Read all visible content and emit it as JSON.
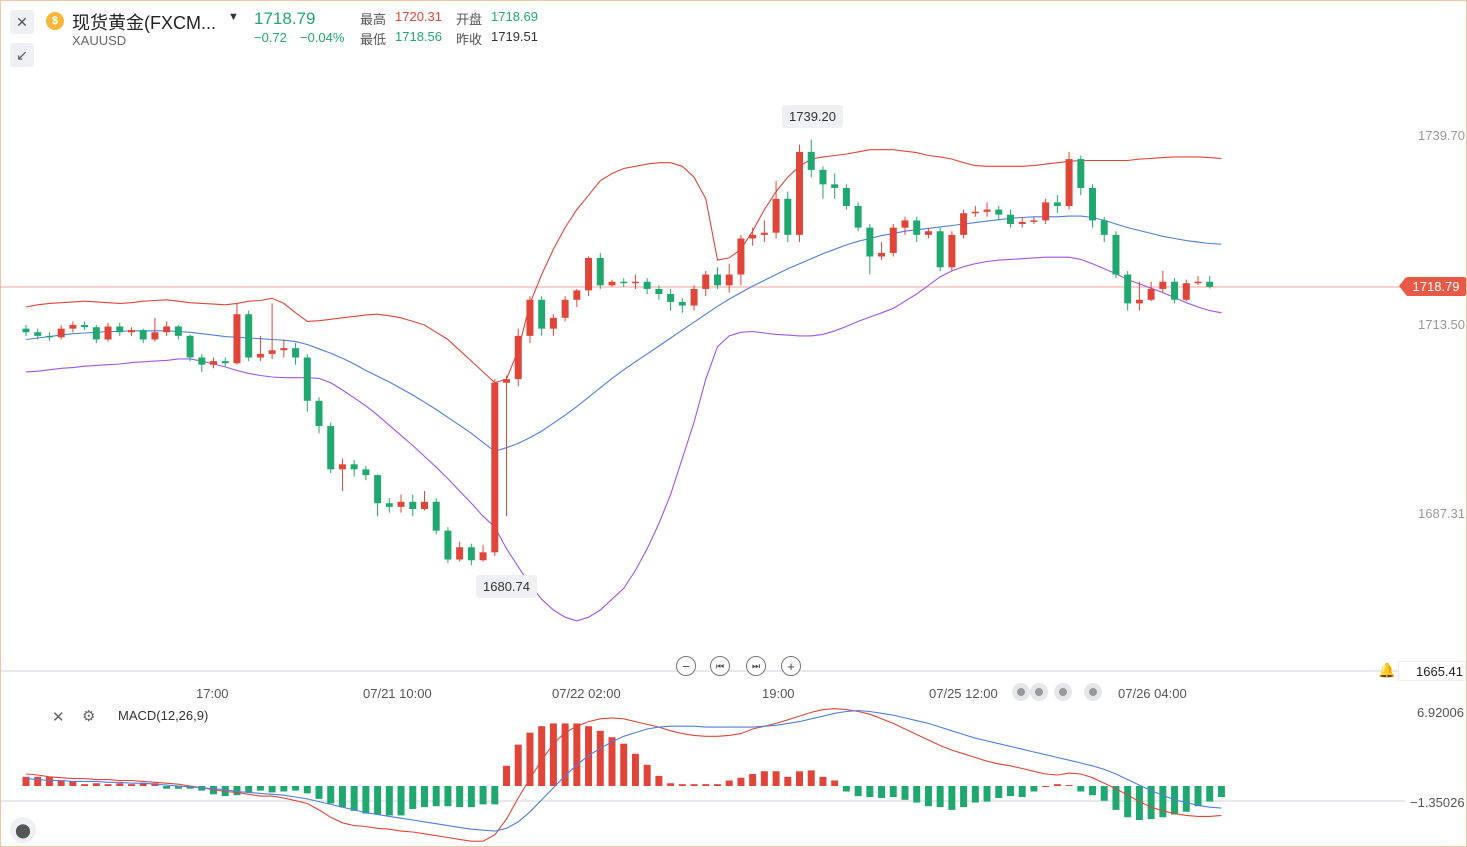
{
  "header": {
    "title": "现货黄金(FXCM...",
    "symbol": "XAUUSD",
    "price": "1718.79",
    "change": "−0.72",
    "change_pct": "−0.04%",
    "high_label": "最高",
    "high_value": "1720.31",
    "open_label": "开盘",
    "open_value": "1718.69",
    "low_label": "最低",
    "low_value": "1718.56",
    "prev_label": "昨收",
    "prev_value": "1719.51",
    "coin_glyph": "$"
  },
  "colors": {
    "up": "#e0453a",
    "down": "#21a870",
    "mid_band": "#4f7fe0",
    "lower_band": "#a055e6",
    "upper_band": "#e0453a"
  },
  "icons": {
    "close": "close-icon",
    "collapse": "collapse-icon",
    "dropdown": "caret-down-icon",
    "alarm": "bell-icon",
    "settings": "gear-icon",
    "indicator": "candles-icon"
  },
  "controls": {
    "zoom_out": "−",
    "prev": "⏮",
    "next": "⏭",
    "zoom_in": "+"
  },
  "chart_data": {
    "type": "candlestick",
    "price_axis": {
      "ticks": [
        "1739.70",
        "1713.50",
        "1687.31",
        "1665.41"
      ],
      "ylim": [
        1660,
        1745
      ]
    },
    "current_price": "1718.79",
    "annotations": {
      "high_marker": "1739.20",
      "low_marker": "1680.74"
    },
    "time_labels": [
      "17:00",
      "07/21 10:00",
      "07/22 02:00",
      "19:00",
      "07/25 12:00",
      "07/26 04:00"
    ],
    "candles": [
      [
        1713.0,
        1712.5,
        1713.5,
        1712.0
      ],
      [
        1712.5,
        1712.0,
        1713.0,
        1711.5
      ],
      [
        1712.0,
        1711.8,
        1712.5,
        1711.3
      ],
      [
        1711.8,
        1713.0,
        1713.5,
        1711.5
      ],
      [
        1713.0,
        1713.5,
        1714.0,
        1712.5
      ],
      [
        1713.5,
        1713.2,
        1714.0,
        1712.8
      ],
      [
        1713.2,
        1711.5,
        1713.5,
        1711.0
      ],
      [
        1711.5,
        1713.3,
        1713.8,
        1711.2
      ],
      [
        1713.3,
        1712.5,
        1713.8,
        1712.0
      ],
      [
        1712.5,
        1712.8,
        1713.2,
        1712.0
      ],
      [
        1712.8,
        1711.5,
        1713.0,
        1711.0
      ],
      [
        1711.5,
        1712.5,
        1714.5,
        1711.2
      ],
      [
        1712.5,
        1713.3,
        1714.0,
        1712.0
      ],
      [
        1713.3,
        1712.0,
        1713.5,
        1711.5
      ],
      [
        1712.0,
        1709.0,
        1712.2,
        1708.5
      ],
      [
        1709.0,
        1708.0,
        1709.5,
        1707.0
      ],
      [
        1708.0,
        1708.5,
        1709.0,
        1707.5
      ],
      [
        1708.5,
        1708.2,
        1709.0,
        1707.8
      ],
      [
        1708.2,
        1715.0,
        1716.5,
        1708.0
      ],
      [
        1715.0,
        1709.0,
        1715.5,
        1708.5
      ],
      [
        1709.0,
        1709.5,
        1712.0,
        1708.5
      ],
      [
        1709.5,
        1710.0,
        1716.5,
        1708.8
      ],
      [
        1710.0,
        1710.3,
        1711.5,
        1709.0
      ],
      [
        1710.3,
        1709.0,
        1711.0,
        1708.0
      ],
      [
        1709.0,
        1703.0,
        1709.5,
        1701.5
      ],
      [
        1703.0,
        1699.5,
        1703.5,
        1698.5
      ],
      [
        1699.5,
        1693.5,
        1700.0,
        1693.0
      ],
      [
        1693.5,
        1694.2,
        1695.0,
        1690.5
      ],
      [
        1694.2,
        1693.5,
        1694.8,
        1692.5
      ],
      [
        1693.5,
        1692.7,
        1694.0,
        1692.0
      ],
      [
        1692.7,
        1688.8,
        1692.8,
        1687.0
      ],
      [
        1688.8,
        1688.3,
        1689.5,
        1687.5
      ],
      [
        1688.3,
        1689.0,
        1690.0,
        1687.5
      ],
      [
        1689.0,
        1688.0,
        1690.0,
        1687.0
      ],
      [
        1688.0,
        1689.0,
        1690.5,
        1687.8
      ],
      [
        1689.0,
        1685.0,
        1689.5,
        1684.5
      ],
      [
        1685.0,
        1681.0,
        1685.5,
        1680.5
      ],
      [
        1681.0,
        1682.7,
        1683.5,
        1680.74
      ],
      [
        1682.7,
        1680.9,
        1683.2,
        1680.2
      ],
      [
        1680.9,
        1682.0,
        1683.0,
        1680.7
      ],
      [
        1682.0,
        1705.5,
        1706.0,
        1681.5
      ],
      [
        1705.5,
        1706.0,
        1706.5,
        1687.0
      ],
      [
        1706.0,
        1712.0,
        1713.0,
        1705.0
      ],
      [
        1712.0,
        1717.0,
        1717.5,
        1711.0
      ],
      [
        1717.0,
        1713.0,
        1717.5,
        1712.0
      ],
      [
        1713.0,
        1714.5,
        1715.0,
        1712.0
      ],
      [
        1714.5,
        1717.0,
        1717.5,
        1714.0
      ],
      [
        1717.0,
        1718.3,
        1718.5,
        1716.0
      ],
      [
        1718.3,
        1722.8,
        1723.0,
        1717.5
      ],
      [
        1722.8,
        1719.0,
        1723.5,
        1718.5
      ],
      [
        1719.0,
        1719.5,
        1719.8,
        1718.8
      ],
      [
        1719.5,
        1719.3,
        1720.0,
        1718.8
      ],
      [
        1719.3,
        1719.5,
        1720.5,
        1718.5
      ],
      [
        1719.5,
        1718.5,
        1720.0,
        1717.8
      ],
      [
        1718.5,
        1717.8,
        1719.0,
        1717.0
      ],
      [
        1717.8,
        1716.7,
        1718.5,
        1715.5
      ],
      [
        1716.7,
        1716.2,
        1717.2,
        1715.2
      ],
      [
        1716.2,
        1718.5,
        1719.0,
        1715.5
      ],
      [
        1718.5,
        1720.5,
        1721.0,
        1717.5
      ],
      [
        1720.5,
        1719.0,
        1721.5,
        1718.5
      ],
      [
        1719.0,
        1720.5,
        1722.0,
        1718.0
      ],
      [
        1720.5,
        1725.5,
        1726.0,
        1719.0
      ],
      [
        1725.5,
        1726.0,
        1727.0,
        1724.5
      ],
      [
        1726.0,
        1726.3,
        1728.0,
        1725.0
      ],
      [
        1726.3,
        1731.0,
        1733.5,
        1725.5
      ],
      [
        1731.0,
        1726.0,
        1732.0,
        1725.0
      ],
      [
        1726.0,
        1737.5,
        1738.5,
        1725.0
      ],
      [
        1737.5,
        1735.0,
        1739.2,
        1734.0
      ],
      [
        1735.0,
        1733.0,
        1735.5,
        1731.0
      ],
      [
        1733.0,
        1732.5,
        1734.5,
        1731.0
      ],
      [
        1732.5,
        1730.0,
        1733.0,
        1729.5
      ],
      [
        1730.0,
        1727.0,
        1730.5,
        1726.5
      ],
      [
        1727.0,
        1723.0,
        1727.5,
        1720.5
      ],
      [
        1723.0,
        1723.5,
        1725.0,
        1722.5
      ],
      [
        1723.5,
        1727.0,
        1727.5,
        1723.0
      ],
      [
        1727.0,
        1728.0,
        1728.5,
        1726.0
      ],
      [
        1728.0,
        1726.0,
        1728.5,
        1725.0
      ],
      [
        1726.0,
        1726.5,
        1727.0,
        1725.5
      ],
      [
        1726.5,
        1721.5,
        1727.0,
        1721.0
      ],
      [
        1721.5,
        1726.0,
        1726.5,
        1721.0
      ],
      [
        1726.0,
        1729.0,
        1729.5,
        1725.5
      ],
      [
        1729.0,
        1729.2,
        1730.0,
        1728.5
      ],
      [
        1729.2,
        1729.5,
        1730.5,
        1728.5
      ],
      [
        1729.5,
        1728.8,
        1730.0,
        1728.0
      ],
      [
        1728.8,
        1727.5,
        1729.5,
        1727.0
      ],
      [
        1727.5,
        1727.8,
        1728.5,
        1727.0
      ],
      [
        1727.8,
        1728.0,
        1728.5,
        1727.5
      ],
      [
        1728.0,
        1730.5,
        1731.0,
        1727.5
      ],
      [
        1730.5,
        1730.0,
        1731.5,
        1729.0
      ],
      [
        1730.0,
        1736.5,
        1737.5,
        1729.5
      ],
      [
        1736.5,
        1732.5,
        1737.0,
        1731.5
      ],
      [
        1732.5,
        1728.0,
        1733.0,
        1727.0
      ],
      [
        1728.0,
        1726.0,
        1728.5,
        1725.0
      ],
      [
        1726.0,
        1720.5,
        1726.5,
        1720.0
      ],
      [
        1720.5,
        1716.5,
        1721.0,
        1715.5
      ],
      [
        1716.5,
        1717.0,
        1719.5,
        1715.5
      ],
      [
        1717.0,
        1718.5,
        1719.5,
        1716.8
      ],
      [
        1718.5,
        1719.5,
        1721.0,
        1718.0
      ],
      [
        1719.5,
        1717.0,
        1720.0,
        1716.5
      ],
      [
        1717.0,
        1719.3,
        1719.8,
        1716.8
      ],
      [
        1719.3,
        1719.5,
        1720.3,
        1719.0
      ],
      [
        1719.5,
        1718.79,
        1720.31,
        1718.56
      ]
    ],
    "bollinger": {
      "upper": [
        1716,
        1716.3,
        1716.5,
        1716.6,
        1716.7,
        1716.8,
        1716.7,
        1716.6,
        1716.5,
        1716.6,
        1716.8,
        1716.9,
        1717,
        1716.8,
        1716.6,
        1716.5,
        1716.4,
        1716.3,
        1716.5,
        1716.8,
        1716.9,
        1717.2,
        1716.5,
        1715.2,
        1714,
        1714.1,
        1714.3,
        1714.5,
        1714.7,
        1714.9,
        1715,
        1714.8,
        1714.5,
        1714,
        1713.5,
        1712.5,
        1711.5,
        1710,
        1708.5,
        1707,
        1705.5,
        1706,
        1710,
        1716.5,
        1720.5,
        1724,
        1727,
        1729.5,
        1731.5,
        1733.5,
        1734.5,
        1735.2,
        1735.5,
        1735.8,
        1736,
        1736,
        1735.5,
        1734,
        1731,
        1722.5,
        1722.8,
        1724,
        1726.5,
        1729.5,
        1732,
        1734,
        1735.5,
        1736.5,
        1736.8,
        1737,
        1737.2,
        1737.5,
        1737.8,
        1737.8,
        1737.8,
        1737.6,
        1737.4,
        1737,
        1736.8,
        1736.5,
        1736,
        1735.6,
        1735.5,
        1735.5,
        1735.5,
        1735.5,
        1735.6,
        1735.8,
        1736,
        1736.2,
        1736.3,
        1736.3,
        1736.3,
        1736.3,
        1736.3,
        1736.5,
        1736.6,
        1736.7,
        1736.8,
        1736.8,
        1736.8,
        1736.7,
        1736.6
      ],
      "mid": [
        1711.5,
        1711.7,
        1711.9,
        1712.1,
        1712.3,
        1712.4,
        1712.5,
        1712.6,
        1712.6,
        1712.7,
        1712.7,
        1712.7,
        1712.7,
        1712.6,
        1712.5,
        1712.3,
        1712.1,
        1711.9,
        1711.8,
        1711.7,
        1711.6,
        1711.5,
        1711.4,
        1711.2,
        1710.8,
        1710.2,
        1709.6,
        1708.9,
        1708.1,
        1707.2,
        1706.4,
        1705.6,
        1704.7,
        1703.8,
        1702.8,
        1701.8,
        1700.7,
        1699.6,
        1698.5,
        1697.2,
        1696,
        1696.5,
        1697.1,
        1697.9,
        1698.8,
        1699.9,
        1701,
        1702.2,
        1703.5,
        1704.8,
        1706.1,
        1707.3,
        1708.4,
        1709.5,
        1710.6,
        1711.7,
        1712.8,
        1713.9,
        1715,
        1716.1,
        1717.1,
        1718,
        1718.9,
        1719.7,
        1720.5,
        1721.3,
        1722,
        1722.7,
        1723.4,
        1724,
        1724.6,
        1725.1,
        1725.5,
        1725.9,
        1726.2,
        1726.5,
        1726.7,
        1726.9,
        1727.1,
        1727.3,
        1727.5,
        1727.7,
        1727.9,
        1728.1,
        1728.3,
        1728.4,
        1728.5,
        1728.5,
        1728.5,
        1728.6,
        1728.6,
        1728.4,
        1728,
        1727.5,
        1727,
        1726.6,
        1726.2,
        1725.8,
        1725.5,
        1725.2,
        1725,
        1724.8,
        1724.7
      ],
      "lower": [
        1707,
        1707.1,
        1707.3,
        1707.5,
        1707.6,
        1707.8,
        1707.9,
        1708,
        1708.1,
        1708.3,
        1708.4,
        1708.5,
        1708.6,
        1708.8,
        1708.8,
        1708.5,
        1708.1,
        1707.7,
        1707.2,
        1706.8,
        1706.5,
        1706.3,
        1706.2,
        1706.2,
        1706.2,
        1706.1,
        1705.5,
        1704.5,
        1703.4,
        1702.3,
        1701,
        1699.6,
        1698.2,
        1696.8,
        1695.3,
        1693.8,
        1692.2,
        1690.5,
        1688.8,
        1687,
        1685.5,
        1682.5,
        1680,
        1677.5,
        1675.5,
        1674,
        1673,
        1672.5,
        1673,
        1674,
        1675.5,
        1677,
        1679.5,
        1682.5,
        1686,
        1690,
        1695,
        1700,
        1706,
        1710.5,
        1712,
        1712.5,
        1712.6,
        1712.4,
        1712.2,
        1712.1,
        1712,
        1712,
        1712.2,
        1712.7,
        1713.3,
        1714,
        1714.6,
        1715.2,
        1715.8,
        1716.8,
        1717.8,
        1719,
        1720.2,
        1721,
        1721.6,
        1722,
        1722.3,
        1722.5,
        1722.6,
        1722.7,
        1722.8,
        1722.9,
        1722.9,
        1722.9,
        1722.6,
        1722,
        1721.3,
        1720.6,
        1719.8,
        1719.2,
        1718.6,
        1718,
        1717.3,
        1716.6,
        1716,
        1715.5,
        1715.2
      ]
    },
    "macd": {
      "title": "MACD(12,26,9)",
      "ticks": [
        "6.92006",
        "−1.35026"
      ],
      "ylim": [
        -6,
        10
      ],
      "histogram": [
        1.0,
        1.0,
        1.0,
        0.6,
        0.5,
        0.2,
        0.3,
        0.2,
        0.3,
        0.2,
        0.3,
        0.3,
        -0.3,
        -0.3,
        -0.3,
        -0.5,
        -0.9,
        -1.1,
        -1.0,
        -0.7,
        -0.5,
        -0.7,
        -0.6,
        -0.5,
        -0.8,
        -1.4,
        -1.9,
        -2.3,
        -2.7,
        -3.0,
        -3.1,
        -3.2,
        -3.2,
        -2.5,
        -2.3,
        -2.2,
        -2.2,
        -2.3,
        -2.3,
        -2.0,
        -2.0,
        2.2,
        4.5,
        5.8,
        6.5,
        6.8,
        6.8,
        6.8,
        6.5,
        6.0,
        5.3,
        4.6,
        3.5,
        2.3,
        1.1,
        0.3,
        0.2,
        0.2,
        0.2,
        0.2,
        0.6,
        0.9,
        1.3,
        1.6,
        1.6,
        1.0,
        1.6,
        1.7,
        1.0,
        0.6,
        -0.6,
        -1.1,
        -1.2,
        -1.3,
        -1.2,
        -1.5,
        -1.8,
        -2.2,
        -2.3,
        -2.6,
        -2.3,
        -1.8,
        -1.7,
        -1.3,
        -1.1,
        -1.2,
        -0.6,
        0,
        0.2,
        0.1,
        -0.6,
        -1.0,
        -1.6,
        -2.6,
        -3.4,
        -3.7,
        -3.6,
        -3.4,
        -3.1,
        -2.8,
        -2.2,
        -1.7,
        -1.2
      ],
      "dif": [
        1.3,
        1.2,
        1.0,
        0.9,
        0.8,
        0.8,
        0.7,
        0.7,
        0.6,
        0.6,
        0.5,
        0.4,
        0.3,
        0.2,
        0.0,
        -0.2,
        -0.4,
        -0.6,
        -0.7,
        -0.9,
        -1.1,
        -1.1,
        -1.3,
        -1.6,
        -1.9,
        -2.6,
        -3.4,
        -4.0,
        -4.3,
        -4.4,
        -4.6,
        -4.7,
        -4.9,
        -5.0,
        -5.2,
        -5.4,
        -5.6,
        -5.8,
        -6.0,
        -6.0,
        -5.3,
        -3.6,
        -1.3,
        0.8,
        2.8,
        4.6,
        5.8,
        6.5,
        7.0,
        7.3,
        7.4,
        7.3,
        7.0,
        6.7,
        6.4,
        6.0,
        5.7,
        5.5,
        5.4,
        5.4,
        5.5,
        5.7,
        6.2,
        6.5,
        6.8,
        7.2,
        7.6,
        8.0,
        8.3,
        8.4,
        8.3,
        8.1,
        7.8,
        7.3,
        6.8,
        6.2,
        5.6,
        5.0,
        4.4,
        3.9,
        3.5,
        3.1,
        2.7,
        2.4,
        2.2,
        1.9,
        1.6,
        1.3,
        1.2,
        1.4,
        1.3,
        0.9,
        0.3,
        -0.3,
        -1.0,
        -1.7,
        -2.3,
        -2.7,
        -3.0,
        -3.2,
        -3.3,
        -3.3,
        -3.2
      ],
      "dea": [
        0.8,
        0.7,
        0.6,
        0.6,
        0.5,
        0.5,
        0.5,
        0.4,
        0.4,
        0.3,
        0.3,
        0.2,
        0.1,
        0.0,
        -0.1,
        -0.2,
        -0.3,
        -0.4,
        -0.6,
        -0.7,
        -0.8,
        -0.9,
        -1.0,
        -1.2,
        -1.4,
        -1.7,
        -2.0,
        -2.3,
        -2.6,
        -2.9,
        -3.1,
        -3.3,
        -3.5,
        -3.7,
        -3.9,
        -4.1,
        -4.3,
        -4.5,
        -4.7,
        -4.8,
        -4.9,
        -4.6,
        -3.9,
        -2.8,
        -1.5,
        -0.2,
        1.1,
        2.3,
        3.3,
        4.1,
        4.8,
        5.4,
        5.8,
        6.2,
        6.4,
        6.5,
        6.5,
        6.5,
        6.4,
        6.4,
        6.4,
        6.4,
        6.4,
        6.5,
        6.6,
        6.8,
        7.0,
        7.3,
        7.6,
        7.9,
        8.1,
        8.2,
        8.1,
        7.9,
        7.7,
        7.4,
        7.1,
        6.8,
        6.4,
        6.0,
        5.6,
        5.2,
        4.9,
        4.6,
        4.3,
        4.0,
        3.7,
        3.4,
        3.1,
        2.8,
        2.5,
        2.2,
        1.8,
        1.3,
        0.7,
        0.1,
        -0.5,
        -1.0,
        -1.5,
        -1.8,
        -2.1,
        -2.3,
        -2.4
      ]
    }
  }
}
